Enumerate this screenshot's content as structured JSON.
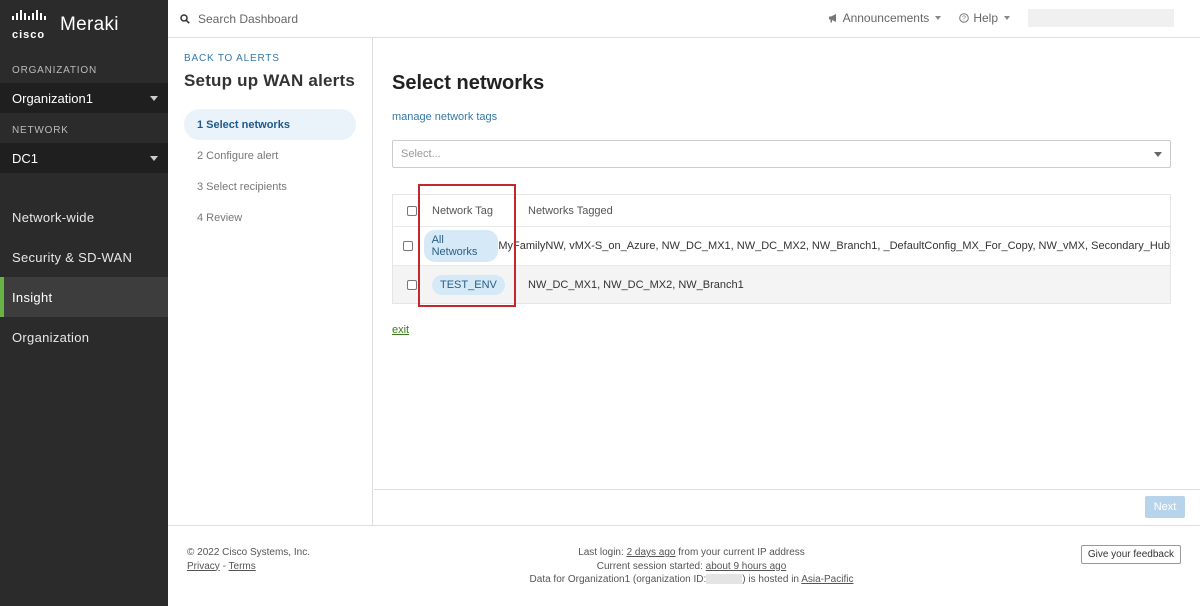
{
  "brand": {
    "cisco": "cisco",
    "product": "Meraki"
  },
  "sidebar": {
    "org_label": "ORGANIZATION",
    "org_value": "Organization1",
    "network_label": "NETWORK",
    "network_value": "DC1",
    "nav": [
      {
        "label": "Network-wide",
        "active": false
      },
      {
        "label": "Security & SD-WAN",
        "active": false
      },
      {
        "label": "Insight",
        "active": true
      },
      {
        "label": "Organization",
        "active": false
      }
    ],
    "active_color": "#67b346"
  },
  "topbar": {
    "search_placeholder": "Search Dashboard",
    "announcements": "Announcements",
    "help": "Help"
  },
  "steps": {
    "back": "BACK TO ALERTS",
    "title": "Setup up WAN alerts",
    "items": [
      {
        "label": "1 Select networks",
        "active": true
      },
      {
        "label": "2 Configure alert",
        "active": false
      },
      {
        "label": "3 Select recipients",
        "active": false
      },
      {
        "label": "4 Review",
        "active": false
      }
    ]
  },
  "main": {
    "title": "Select networks",
    "manage_link": "manage network tags",
    "select_placeholder": "Select...",
    "table": {
      "col_tag": "Network Tag",
      "col_networks": "Networks Tagged",
      "rows": [
        {
          "tag": "All Networks",
          "networks": "MyFamilyNW, vMX-S_on_Azure, NW_DC_MX1, NW_DC_MX2, NW_Branch1, _DefaultConfig_MX_For_Copy, NW_vMX, Secondary_Hub"
        },
        {
          "tag": "TEST_ENV",
          "networks": "NW_DC_MX1, NW_DC_MX2, NW_Branch1"
        }
      ]
    },
    "exit": "exit",
    "next": "Next"
  },
  "footer": {
    "copyright": "© 2022 Cisco Systems, Inc.",
    "privacy": "Privacy",
    "separator": " - ",
    "terms": "Terms",
    "last_login_prefix": "Last login: ",
    "last_login_link": "2 days ago",
    "last_login_suffix": " from your current IP address",
    "session_prefix": "Current session started: ",
    "session_link": "about 9 hours ago",
    "data_prefix": "Data for Organization1 (organization ID:",
    "data_mid": ") is hosted in ",
    "region_link": "Asia-Pacific",
    "feedback": "Give your feedback"
  },
  "colors": {
    "highlight": "#c0282d",
    "link": "#3478a8",
    "tag_bg": "#d6e9f7"
  }
}
